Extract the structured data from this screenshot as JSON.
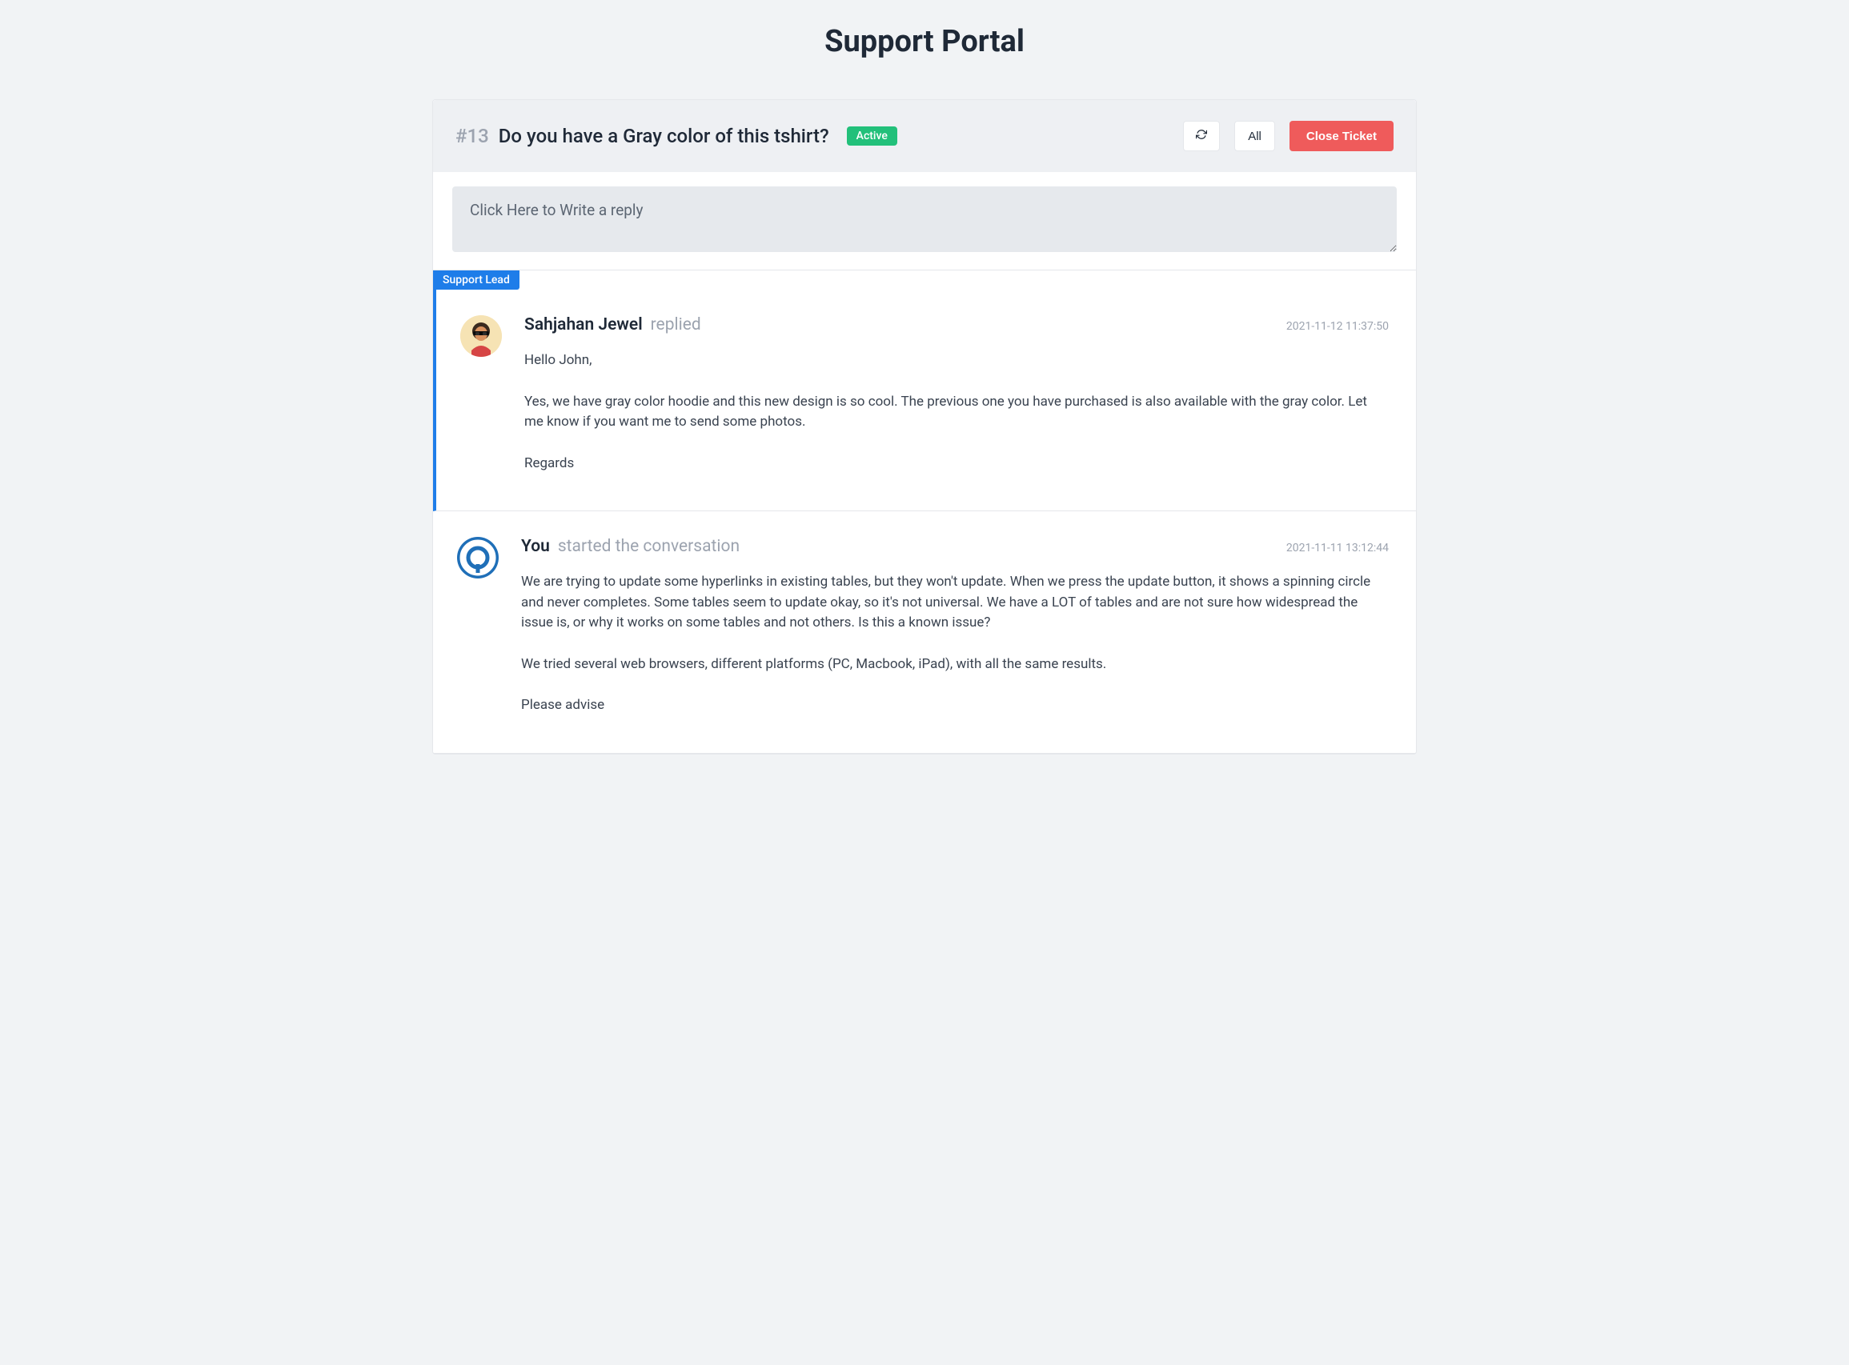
{
  "header": {
    "title": "Support Portal"
  },
  "ticket": {
    "id_prefix": "#13",
    "subject": "Do you have a Gray color of this tshirt?",
    "status": "Active"
  },
  "actions": {
    "all_label": "All",
    "close_label": "Close Ticket"
  },
  "reply": {
    "placeholder": "Click Here to Write a reply"
  },
  "conversations": [
    {
      "role": "Support Lead",
      "author": "Sahjahan Jewel",
      "action": "replied",
      "timestamp": "2021-11-12 11:37:50",
      "lines": [
        "Hello John,",
        "",
        "Yes, we have gray color hoodie and this new design is so cool. The previous one you have purchased is also available with the gray color. Let me know if you want me to send some photos.",
        "",
        "Regards"
      ]
    },
    {
      "author": "You",
      "action": "started the conversation",
      "timestamp": "2021-11-11 13:12:44",
      "lines": [
        "We are trying to update some hyperlinks in existing tables, but they won't update. When we press the update button, it shows a spinning circle and never completes. Some tables seem to update okay, so it's not universal. We have a LOT of tables and are not sure how widespread the issue is, or why it works on some tables and not others. Is this a known issue?",
        "",
        "We tried several web browsers, different platforms (PC, Macbook, iPad), with all the same results.",
        "",
        "Please advise"
      ]
    }
  ]
}
